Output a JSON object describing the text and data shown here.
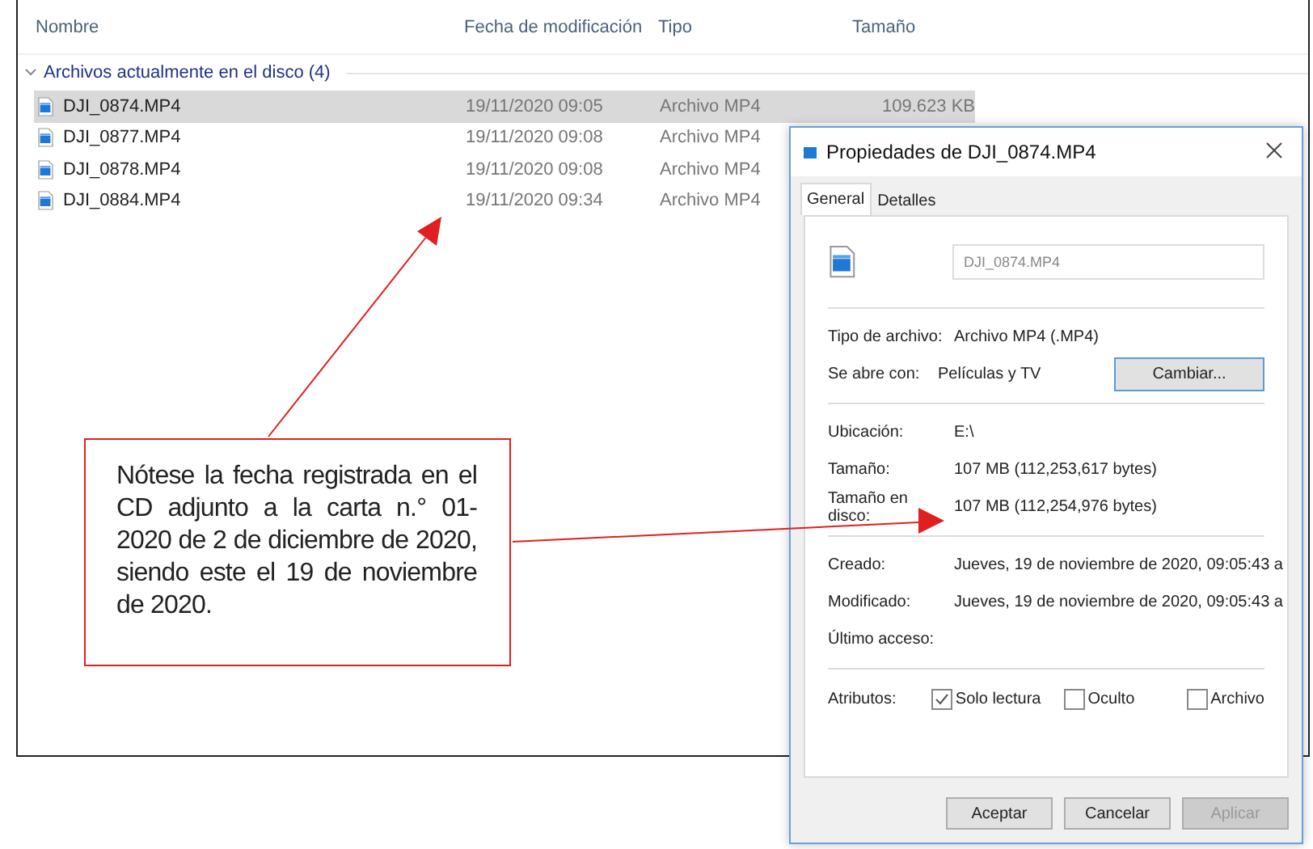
{
  "explorer": {
    "columns": [
      "Nombre",
      "Fecha de modificación",
      "Tipo",
      "Tamaño"
    ],
    "group": {
      "label": "Archivos actualmente en el disco (4)",
      "expanded": true
    },
    "rows": [
      {
        "name": "DJI_0874.MP4",
        "date": "19/11/2020 09:05",
        "type": "Archivo MP4",
        "size": "109.623 KB",
        "selected": true
      },
      {
        "name": "DJI_0877.MP4",
        "date": "19/11/2020 09:08",
        "type": "Archivo MP4",
        "selected": false
      },
      {
        "name": "DJI_0878.MP4",
        "date": "19/11/2020 09:08",
        "type": "Archivo MP4",
        "selected": false
      },
      {
        "name": "DJI_0884.MP4",
        "date": "19/11/2020 09:34",
        "type": "Archivo MP4",
        "selected": false
      }
    ]
  },
  "dialog": {
    "title": "Propiedades de DJI_0874.MP4",
    "tabs": [
      {
        "label": "General",
        "selected": true
      },
      {
        "label": "Detalles",
        "selected": false
      }
    ],
    "filename": "DJI_0874.MP4",
    "sections": [
      [
        {
          "label": "Tipo de archivo:",
          "value": "Archivo MP4 (.MP4)"
        },
        {
          "label": "Se abre con:",
          "value": "Películas y TV",
          "button": "Cambiar..."
        }
      ],
      [
        {
          "label": "Ubicación:",
          "value": "E:\\"
        },
        {
          "label": "Tamaño:",
          "value": "107 MB (112,253,617 bytes)"
        },
        {
          "label": "Tamaño en disco:",
          "value": "107 MB (112,254,976 bytes)"
        }
      ],
      [
        {
          "label": "Creado:",
          "value": "Jueves, 19 de noviembre de 2020, 09:05:43 a"
        },
        {
          "label": "Modificado:",
          "value": "Jueves, 19 de noviembre de 2020, 09:05:43 a"
        },
        {
          "label": "Último acceso:"
        }
      ]
    ],
    "attributes": {
      "label": "Atributos:",
      "items": [
        {
          "label": "Solo lectura",
          "checked": true
        },
        {
          "label": "Oculto",
          "checked": false
        },
        {
          "label": "Archivo",
          "checked": false
        }
      ]
    },
    "buttons": [
      {
        "label": "Aceptar",
        "disabled": false
      },
      {
        "label": "Cancelar",
        "disabled": false
      },
      {
        "label": "Aplicar",
        "disabled": true
      }
    ]
  },
  "callout": {
    "text": "Nótese la fecha registrada en el CD adjunto a la carta n.° 01-2020 de 2 de diciembre de 2020, siendo este el 19 de noviembre de 2020."
  }
}
